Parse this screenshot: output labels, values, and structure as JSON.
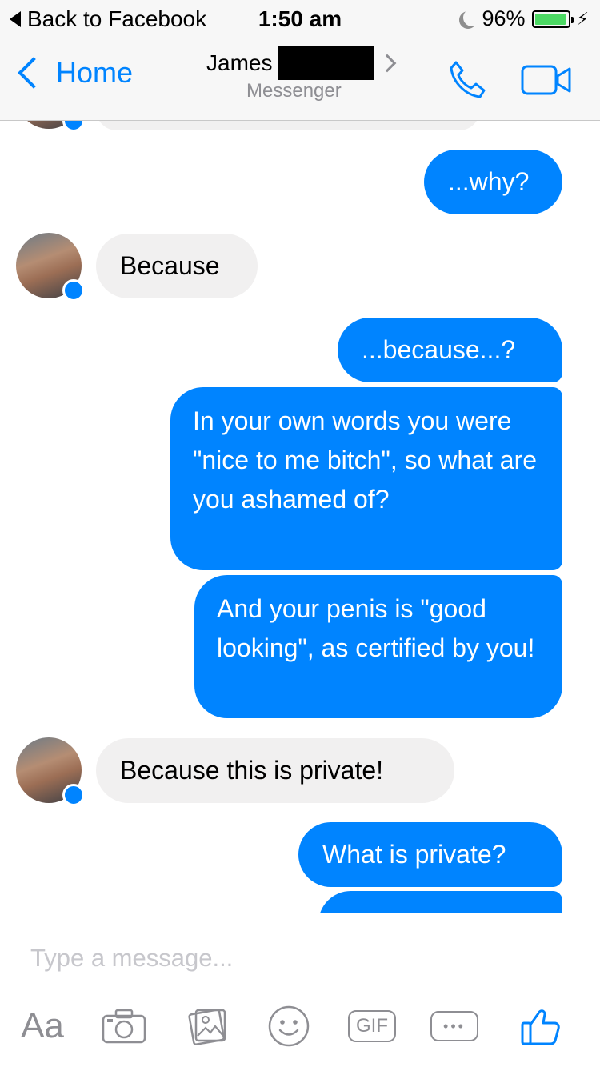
{
  "status_bar": {
    "back_label": "Back to Facebook",
    "time": "1:50 am",
    "battery_percent": "96%",
    "battery_level": 0.96
  },
  "nav": {
    "back_label": "Home",
    "contact_first_name": "James",
    "subtitle": "Messenger"
  },
  "messages": [
    {
      "direction": "out",
      "text": "...why?"
    },
    {
      "direction": "in",
      "text": "Because"
    },
    {
      "direction": "out",
      "text": "...because...?"
    },
    {
      "direction": "out",
      "text": "In your own words you were \"nice to me bitch\", so what are you ashamed of?"
    },
    {
      "direction": "out",
      "text": "And your penis is \"good looking\", as certified by you!"
    },
    {
      "direction": "in",
      "text": "Because this is private!"
    },
    {
      "direction": "out",
      "text": "What is private?"
    }
  ],
  "composer": {
    "placeholder": "Type a message...",
    "aa_label": "Aa",
    "gif_label": "GIF"
  },
  "colors": {
    "accent": "#0084ff",
    "incoming_bubble": "#f1f0f0",
    "bar_background": "#f7f7f7"
  },
  "icons": [
    "camera-icon",
    "photo-icon",
    "emoji-icon",
    "gif-icon",
    "more-icon",
    "like-icon",
    "phone-icon",
    "video-icon"
  ]
}
